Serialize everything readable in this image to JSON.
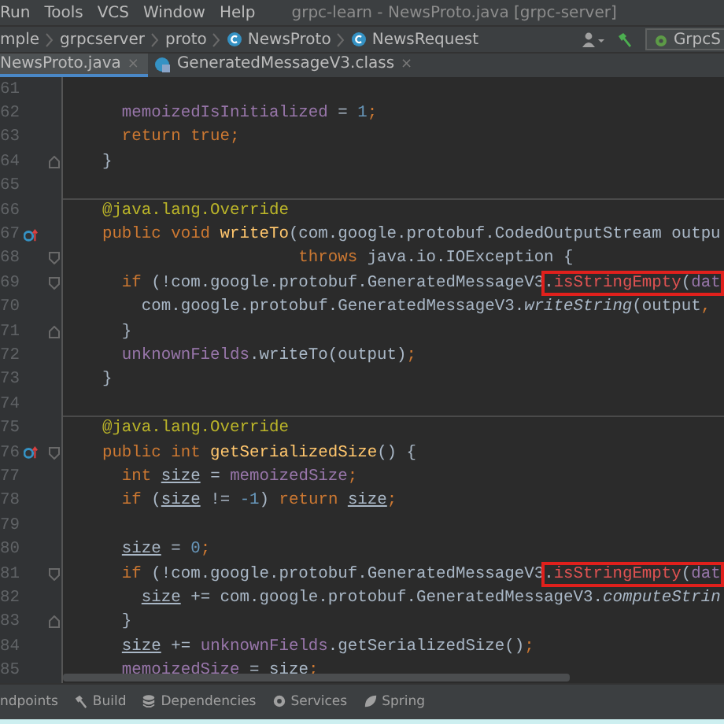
{
  "menu_bar": {
    "items": [
      "Run",
      "Tools",
      "VCS",
      "Window",
      "Help"
    ],
    "title": "grpc-learn - NewsProto.java [grpc-server]"
  },
  "breadcrumbs": [
    {
      "label": "mple",
      "kind": "folder"
    },
    {
      "label": "grpcserver",
      "kind": "folder"
    },
    {
      "label": "proto",
      "kind": "folder"
    },
    {
      "label": "NewsProto",
      "kind": "class"
    },
    {
      "label": "NewsRequest",
      "kind": "class"
    }
  ],
  "toolbar": {
    "run_config": "GrpcS"
  },
  "tabs": [
    {
      "label": "NewsProto.java",
      "close": "×",
      "selected": true
    },
    {
      "label": "GeneratedMessageV3.class",
      "close": "×",
      "selected": false
    }
  ],
  "editor": {
    "lines": [
      {
        "number": "61",
        "separator": false,
        "override": false,
        "fold_start": false,
        "fold_end": false
      },
      {
        "number": "62",
        "separator": false,
        "override": false,
        "fold_start": false,
        "fold_end": false,
        "tokens": [
          {
            "text": "      memoizedIsInitialized",
            "kind": "field"
          },
          {
            "text": " = "
          },
          {
            "text": "1",
            "kind": "num"
          },
          {
            "text": ";",
            "kind": "kw"
          }
        ]
      },
      {
        "number": "63",
        "separator": false,
        "override": false,
        "fold_start": false,
        "fold_end": false,
        "tokens": [
          {
            "text": "      return true;",
            "kind": "kw"
          }
        ]
      },
      {
        "number": "64",
        "separator": false,
        "override": false,
        "fold_start": false,
        "fold_end": true,
        "tokens": [
          {
            "text": "    }"
          }
        ]
      },
      {
        "number": "65",
        "separator": false,
        "override": false,
        "fold_start": false,
        "fold_end": false
      },
      {
        "number": "66",
        "separator": true,
        "override": false,
        "fold_start": false,
        "fold_end": false,
        "tokens": [
          {
            "text": "    @java.lang.Override",
            "kind": "ann"
          }
        ]
      },
      {
        "number": "67",
        "separator": false,
        "override": true,
        "fold_start": false,
        "fold_end": false,
        "tokens": [
          {
            "text": "    public void ",
            "kind": "kw"
          },
          {
            "text": "writeTo",
            "kind": "decl"
          },
          {
            "text": "(com.google.protobuf.CodedOutputStream outpu"
          }
        ]
      },
      {
        "number": "68",
        "separator": false,
        "override": false,
        "fold_start": true,
        "fold_end": false,
        "tokens": [
          {
            "text": "                        throws ",
            "kind": "kw"
          },
          {
            "text": "java.io.IOException {"
          }
        ]
      },
      {
        "number": "69",
        "separator": false,
        "override": false,
        "fold_start": true,
        "fold_end": false,
        "tokens": [
          {
            "text": "      if ",
            "kind": "kw"
          },
          {
            "text": "(!com.google.protobuf.GeneratedMessageV3"
          },
          {
            "kind": "box",
            "tokens": [
              {
                "text": "."
              },
              {
                "text": "isStringEmpty",
                "kind": "err"
              },
              {
                "text": "("
              },
              {
                "text": "dat",
                "kind": "field"
              }
            ]
          }
        ]
      },
      {
        "number": "70",
        "separator": false,
        "override": false,
        "fold_start": false,
        "fold_end": false,
        "tokens": [
          {
            "text": "        com.google.protobuf.GeneratedMessageV3."
          },
          {
            "text": "writeString",
            "kind": "static"
          },
          {
            "text": "(output"
          },
          {
            "text": ",",
            "kind": "kw"
          }
        ]
      },
      {
        "number": "71",
        "separator": false,
        "override": false,
        "fold_start": false,
        "fold_end": true,
        "tokens": [
          {
            "text": "      }"
          }
        ]
      },
      {
        "number": "72",
        "separator": false,
        "override": false,
        "fold_start": false,
        "fold_end": false,
        "tokens": [
          {
            "text": "      unknownFields",
            "kind": "field"
          },
          {
            "text": ".writeTo(output)"
          },
          {
            "text": ";",
            "kind": "kw"
          }
        ]
      },
      {
        "number": "73",
        "separator": false,
        "override": false,
        "fold_start": false,
        "fold_end": false,
        "tokens": [
          {
            "text": "    }"
          }
        ]
      },
      {
        "number": "74",
        "separator": false,
        "override": false,
        "fold_start": false,
        "fold_end": false
      },
      {
        "number": "75",
        "separator": true,
        "override": false,
        "fold_start": false,
        "fold_end": false,
        "tokens": [
          {
            "text": "    @java.lang.Override",
            "kind": "ann"
          }
        ]
      },
      {
        "number": "76",
        "separator": false,
        "override": true,
        "fold_start": true,
        "fold_end": false,
        "tokens": [
          {
            "text": "    public int ",
            "kind": "kw"
          },
          {
            "text": "getSerializedSize",
            "kind": "decl"
          },
          {
            "text": "() {"
          }
        ]
      },
      {
        "number": "77",
        "separator": false,
        "override": false,
        "fold_start": false,
        "fold_end": false,
        "tokens": [
          {
            "text": "      int ",
            "kind": "kw"
          },
          {
            "text": "size",
            "kind": "var"
          },
          {
            "text": " = "
          },
          {
            "text": "memoizedSize",
            "kind": "field"
          },
          {
            "text": ";",
            "kind": "kw"
          }
        ]
      },
      {
        "number": "78",
        "separator": false,
        "override": false,
        "fold_start": false,
        "fold_end": false,
        "tokens": [
          {
            "text": "      if ",
            "kind": "kw"
          },
          {
            "text": "("
          },
          {
            "text": "size",
            "kind": "var"
          },
          {
            "text": " != "
          },
          {
            "text": "-1",
            "kind": "num"
          },
          {
            "text": ") "
          },
          {
            "text": "return ",
            "kind": "kw"
          },
          {
            "text": "size",
            "kind": "var"
          },
          {
            "text": ";",
            "kind": "kw"
          }
        ]
      },
      {
        "number": "79",
        "separator": false,
        "override": false,
        "fold_start": false,
        "fold_end": false
      },
      {
        "number": "80",
        "separator": false,
        "override": false,
        "fold_start": false,
        "fold_end": false,
        "tokens": [
          {
            "text": "      size",
            "kind": "var"
          },
          {
            "text": " = "
          },
          {
            "text": "0",
            "kind": "num"
          },
          {
            "text": ";",
            "kind": "kw"
          }
        ]
      },
      {
        "number": "81",
        "separator": false,
        "override": false,
        "fold_start": true,
        "fold_end": false,
        "tokens": [
          {
            "text": "      if ",
            "kind": "kw"
          },
          {
            "text": "(!com.google.protobuf.GeneratedMessageV3"
          },
          {
            "kind": "box",
            "tokens": [
              {
                "text": "."
              },
              {
                "text": "isStringEmpty",
                "kind": "err"
              },
              {
                "text": "("
              },
              {
                "text": "dat",
                "kind": "field"
              }
            ]
          }
        ]
      },
      {
        "number": "82",
        "separator": false,
        "override": false,
        "fold_start": false,
        "fold_end": false,
        "tokens": [
          {
            "text": "        size",
            "kind": "var"
          },
          {
            "text": " += com.google.protobuf.GeneratedMessageV3."
          },
          {
            "text": "computeStrin",
            "kind": "static"
          }
        ]
      },
      {
        "number": "83",
        "separator": false,
        "override": false,
        "fold_start": false,
        "fold_end": true,
        "tokens": [
          {
            "text": "      }"
          }
        ]
      },
      {
        "number": "84",
        "separator": false,
        "override": false,
        "fold_start": false,
        "fold_end": false,
        "tokens": [
          {
            "text": "      size",
            "kind": "var"
          },
          {
            "text": " += "
          },
          {
            "text": "unknownFields",
            "kind": "field"
          },
          {
            "text": ".getSerializedSize()"
          },
          {
            "text": ";",
            "kind": "kw"
          }
        ]
      },
      {
        "number": "85",
        "separator": false,
        "override": false,
        "fold_start": false,
        "fold_end": false,
        "tokens": [
          {
            "text": "      memoizedSize",
            "kind": "field"
          },
          {
            "text": " = "
          },
          {
            "text": "size",
            "kind": "var"
          },
          {
            "text": ";",
            "kind": "kw"
          }
        ]
      }
    ]
  },
  "tool_windows": [
    {
      "label": "ndpoints",
      "kind": "none"
    },
    {
      "label": "Build",
      "kind": "hammer"
    },
    {
      "label": "Dependencies",
      "kind": "deps"
    },
    {
      "label": "Services",
      "kind": "services"
    },
    {
      "label": "Spring",
      "kind": "spring"
    }
  ]
}
